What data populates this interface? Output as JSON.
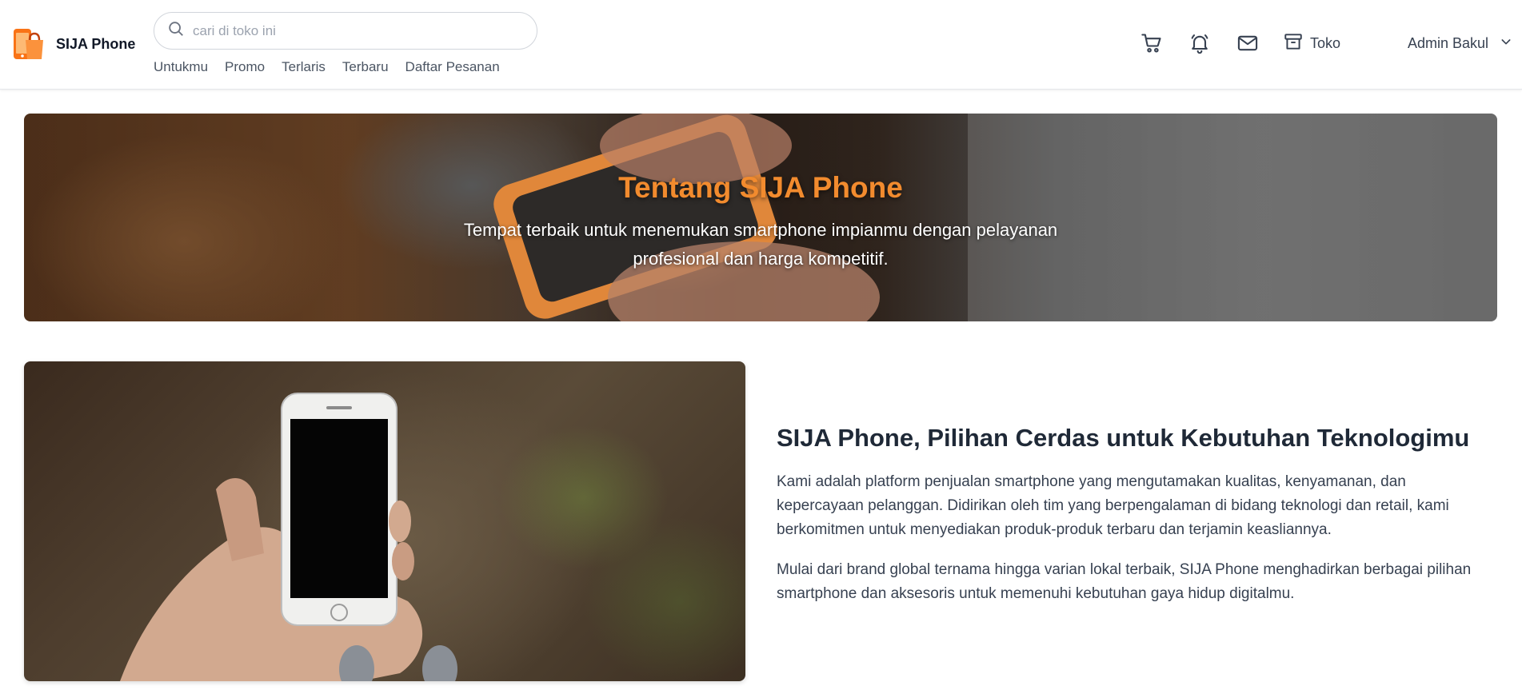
{
  "brand": {
    "name": "SIJA Phone",
    "accent": "#f28b2e"
  },
  "search": {
    "placeholder": "cari di toko ini"
  },
  "nav": [
    "Untukmu",
    "Promo",
    "Terlaris",
    "Terbaru",
    "Daftar Pesanan"
  ],
  "actions": {
    "icons": [
      "cart-icon",
      "bell-icon",
      "mail-icon",
      "store-icon"
    ],
    "store_label": "Toko"
  },
  "user": {
    "name": "Admin Bakul"
  },
  "hero": {
    "title": "Tentang SIJA Phone",
    "subtitle": "Tempat terbaik untuk menemukan smartphone impianmu dengan pelayanan profesional dan harga kompetitif."
  },
  "about": {
    "title": "SIJA Phone, Pilihan Cerdas untuk Kebutuhan Teknologimu",
    "paragraphs": [
      "Kami adalah platform penjualan smartphone yang mengutamakan kualitas, kenyamanan, dan kepercayaan pelanggan. Didirikan oleh tim yang berpengalaman di bidang teknologi dan retail, kami berkomitmen untuk menyediakan produk-produk terbaru dan terjamin keasliannya.",
      "Mulai dari brand global ternama hingga varian lokal terbaik, SIJA Phone menghadirkan berbagai pilihan smartphone dan aksesoris untuk memenuhi kebutuhan gaya hidup digitalmu."
    ]
  }
}
